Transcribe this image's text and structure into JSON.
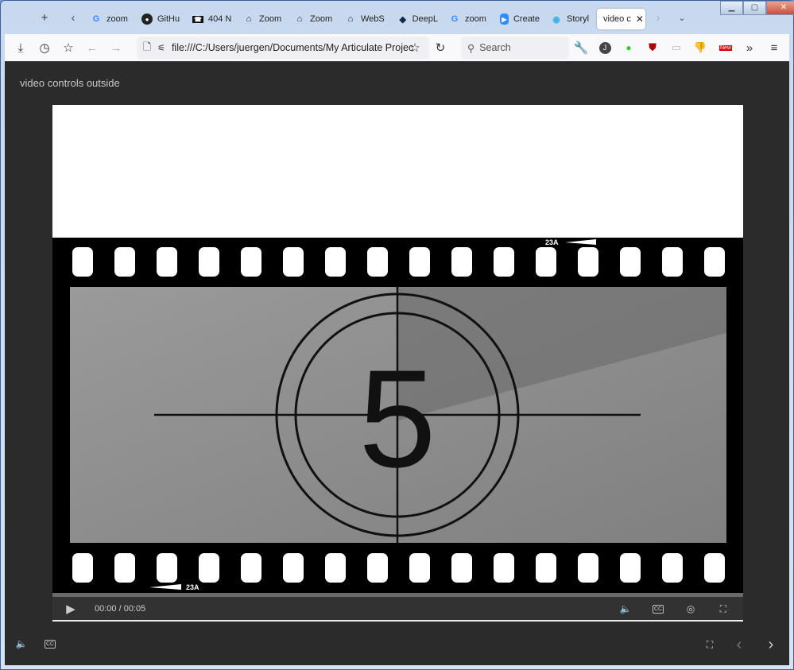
{
  "browser": {
    "tabs": [
      {
        "label": "zoom",
        "icon": "google-icon"
      },
      {
        "label": "GitHu",
        "icon": "github-icon"
      },
      {
        "label": "404 N",
        "icon": "phone-icon"
      },
      {
        "label": "Zoom",
        "icon": "home-icon"
      },
      {
        "label": "Zoom",
        "icon": "home-icon"
      },
      {
        "label": "WebS",
        "icon": "home-icon"
      },
      {
        "label": "DeepL",
        "icon": "deepl-icon"
      },
      {
        "label": "zoom",
        "icon": "google-icon"
      },
      {
        "label": "Create",
        "icon": "zoom-icon"
      },
      {
        "label": "Storyl",
        "icon": "storyline-icon"
      }
    ],
    "active_tab": "video c",
    "url": "file:///C:/Users/juergen/Documents/My Articulate Projec",
    "search_placeholder": "Search",
    "profile_initial": "J",
    "new_badge": "New"
  },
  "page": {
    "title": "video controls outside",
    "video": {
      "countdown": "5",
      "film_label_top": "23A",
      "film_label_bottom": "23A",
      "time": "00:00 / 00:05",
      "progress": 0
    },
    "accent": "#2b2b2b"
  }
}
